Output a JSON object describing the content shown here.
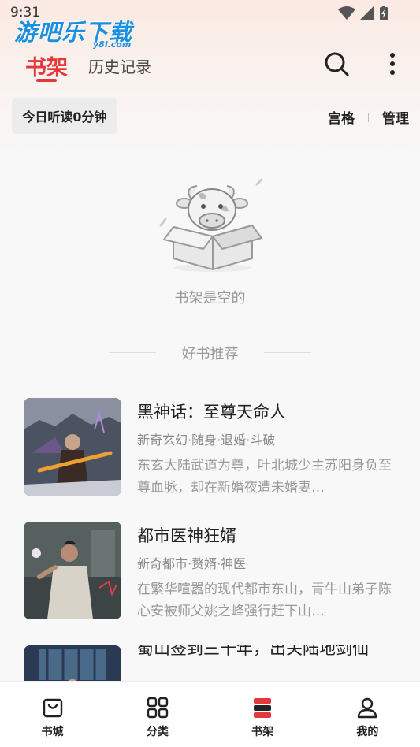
{
  "status_bar": {
    "time": "9:31"
  },
  "watermark": {
    "text": "游吧乐下载",
    "sub": "y8l.com"
  },
  "header": {
    "tabs": [
      {
        "label": "书架",
        "active": true
      },
      {
        "label": "历史记录",
        "active": false
      }
    ],
    "icons": [
      "search-icon",
      "more-vertical-icon"
    ]
  },
  "toolbar": {
    "listen_today": "今日听读0分钟",
    "grid_label": "宫格",
    "manage_label": "管理"
  },
  "empty_state": {
    "text": "书架是空的",
    "icon": "empty-box-cow-illustration"
  },
  "recommend": {
    "title": "好书推荐",
    "books": [
      {
        "title": "黑神话：至尊天命人",
        "tags": "新奇玄幻·随身·退婚·斗破",
        "desc": "东玄大陆武道为尊，叶北城少主苏阳身负至尊血脉，却在新婚夜遭未婚妻…"
      },
      {
        "title": "都市医神狂婿",
        "tags": "新奇都市·赘婿·神医",
        "desc": "在繁华喧嚣的现代都市东山，青牛山弟子陈心安被师父姚之峰强行赶下山…"
      },
      {
        "title": "蜀山签到三千年，出关陆地剑仙",
        "tags": "",
        "desc": ""
      }
    ]
  },
  "bottom_nav": [
    {
      "label": "书城",
      "icon": "bag-icon",
      "active": false
    },
    {
      "label": "分类",
      "icon": "grid-icon",
      "active": false
    },
    {
      "label": "书架",
      "icon": "bookshelf-icon",
      "active": true
    },
    {
      "label": "我的",
      "icon": "user-icon",
      "active": false
    }
  ],
  "colors": {
    "accent": "#e4393c",
    "text_primary": "#222222",
    "text_secondary": "#999999"
  }
}
